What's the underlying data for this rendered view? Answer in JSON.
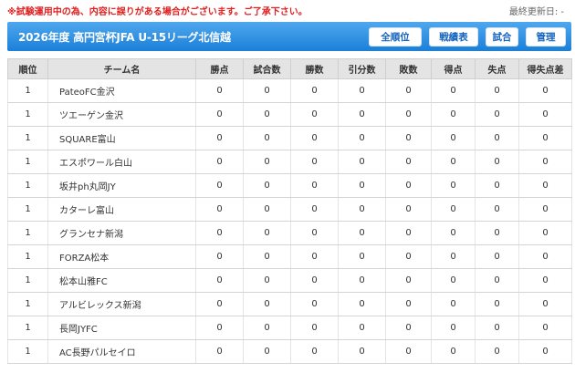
{
  "notice": "※試験運用中の為、内容に誤りがある場合がございます。ご了承下さい。",
  "last_updated_label": "最終更新日: -",
  "league_title": "2026年度 高円宮杯JFA U-15リーグ北信越",
  "tabs": [
    "全順位",
    "戦績表",
    "試合",
    "管理"
  ],
  "columns": [
    "順位",
    "チーム名",
    "勝点",
    "試合数",
    "勝数",
    "引分数",
    "敗数",
    "得点",
    "失点",
    "得失点差"
  ],
  "rows": [
    {
      "rank": "1",
      "team": "PateoFC金沢",
      "points": "0",
      "played": "0",
      "won": "0",
      "drawn": "0",
      "lost": "0",
      "gf": "0",
      "ga": "0",
      "gd": "0"
    },
    {
      "rank": "1",
      "team": "ツエーゲン金沢",
      "points": "0",
      "played": "0",
      "won": "0",
      "drawn": "0",
      "lost": "0",
      "gf": "0",
      "ga": "0",
      "gd": "0"
    },
    {
      "rank": "1",
      "team": "SQUARE富山",
      "points": "0",
      "played": "0",
      "won": "0",
      "drawn": "0",
      "lost": "0",
      "gf": "0",
      "ga": "0",
      "gd": "0"
    },
    {
      "rank": "1",
      "team": "エスポワール白山",
      "points": "0",
      "played": "0",
      "won": "0",
      "drawn": "0",
      "lost": "0",
      "gf": "0",
      "ga": "0",
      "gd": "0"
    },
    {
      "rank": "1",
      "team": "坂井ph丸岡JY",
      "points": "0",
      "played": "0",
      "won": "0",
      "drawn": "0",
      "lost": "0",
      "gf": "0",
      "ga": "0",
      "gd": "0"
    },
    {
      "rank": "1",
      "team": "カターレ富山",
      "points": "0",
      "played": "0",
      "won": "0",
      "drawn": "0",
      "lost": "0",
      "gf": "0",
      "ga": "0",
      "gd": "0"
    },
    {
      "rank": "1",
      "team": "グランセナ新潟",
      "points": "0",
      "played": "0",
      "won": "0",
      "drawn": "0",
      "lost": "0",
      "gf": "0",
      "ga": "0",
      "gd": "0"
    },
    {
      "rank": "1",
      "team": "FORZA松本",
      "points": "0",
      "played": "0",
      "won": "0",
      "drawn": "0",
      "lost": "0",
      "gf": "0",
      "ga": "0",
      "gd": "0"
    },
    {
      "rank": "1",
      "team": "松本山雅FC",
      "points": "0",
      "played": "0",
      "won": "0",
      "drawn": "0",
      "lost": "0",
      "gf": "0",
      "ga": "0",
      "gd": "0"
    },
    {
      "rank": "1",
      "team": "アルビレックス新潟",
      "points": "0",
      "played": "0",
      "won": "0",
      "drawn": "0",
      "lost": "0",
      "gf": "0",
      "ga": "0",
      "gd": "0"
    },
    {
      "rank": "1",
      "team": "長岡JYFC",
      "points": "0",
      "played": "0",
      "won": "0",
      "drawn": "0",
      "lost": "0",
      "gf": "0",
      "ga": "0",
      "gd": "0"
    },
    {
      "rank": "1",
      "team": "AC長野パルセイロ",
      "points": "0",
      "played": "0",
      "won": "0",
      "drawn": "0",
      "lost": "0",
      "gf": "0",
      "ga": "0",
      "gd": "0"
    }
  ],
  "colors": {
    "title_bar": "#1b7fd8",
    "notice": "#e02020",
    "tab_text": "#1565c0",
    "header_bg": "#e4e4e4"
  }
}
